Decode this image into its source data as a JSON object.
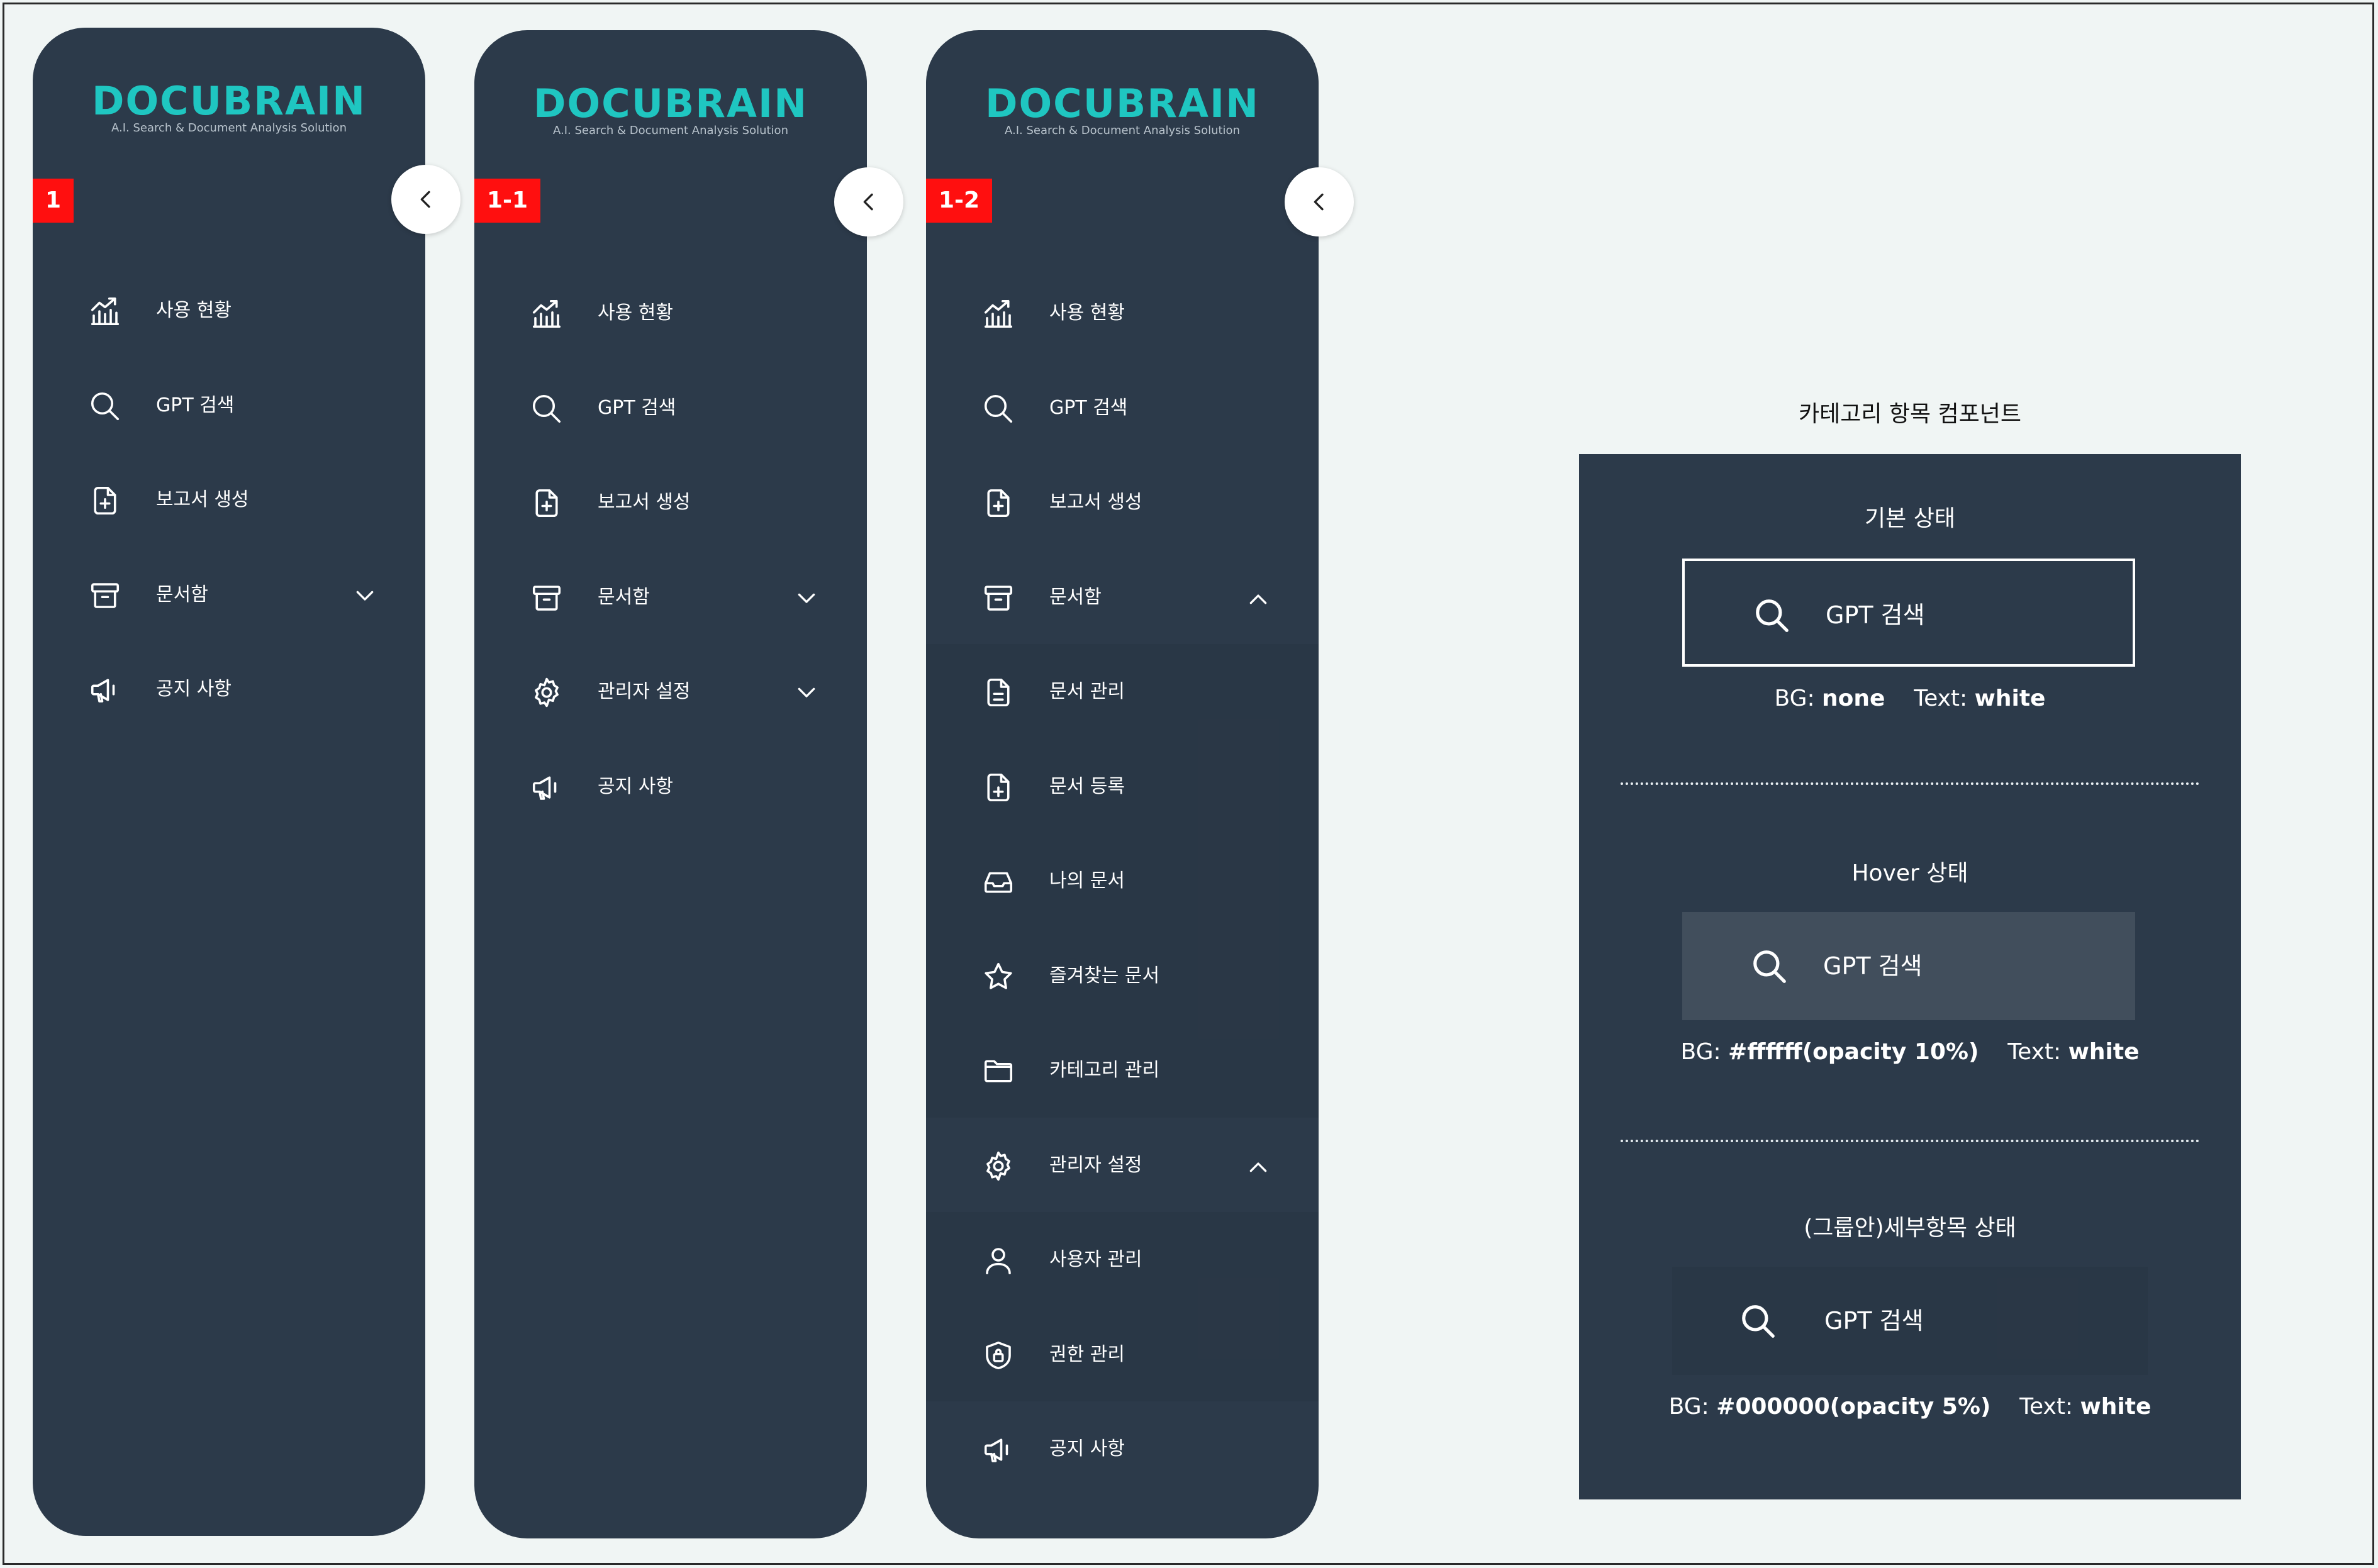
{
  "brand": {
    "name": "DOCUBRAIN",
    "tagline": "A.I. Search & Document Analysis Solution",
    "accent": "#1fc6c1"
  },
  "colors": {
    "sidebar_bg": "#2c3a4a",
    "badge": "#ff0f0f",
    "page_bg": "#f0f5f4"
  },
  "panels": [
    {
      "badge": "1",
      "items": [
        {
          "icon": "chart-icon",
          "label": "사용 현황"
        },
        {
          "icon": "search-icon",
          "label": "GPT 검색"
        },
        {
          "icon": "file-sparkle-icon",
          "label": "보고서 생성"
        },
        {
          "icon": "archive-icon",
          "label": "문서함",
          "chevron": "down"
        },
        {
          "icon": "megaphone-icon",
          "label": "공지 사항"
        }
      ]
    },
    {
      "badge": "1-1",
      "items": [
        {
          "icon": "chart-icon",
          "label": "사용 현황"
        },
        {
          "icon": "search-icon",
          "label": "GPT 검색"
        },
        {
          "icon": "file-sparkle-icon",
          "label": "보고서 생성"
        },
        {
          "icon": "archive-icon",
          "label": "문서함",
          "chevron": "down"
        },
        {
          "icon": "gear-icon",
          "label": "관리자 설정",
          "chevron": "down"
        },
        {
          "icon": "megaphone-icon",
          "label": "공지 사항"
        }
      ]
    },
    {
      "badge": "1-2",
      "items": [
        {
          "icon": "chart-icon",
          "label": "사용 현황"
        },
        {
          "icon": "search-icon",
          "label": "GPT 검색"
        },
        {
          "icon": "file-sparkle-icon",
          "label": "보고서 생성"
        },
        {
          "icon": "archive-icon",
          "label": "문서함",
          "chevron": "up"
        },
        {
          "icon": "document-icon",
          "label": "문서 관리",
          "sub": true
        },
        {
          "icon": "file-plus-icon",
          "label": "문서 등록",
          "sub": true
        },
        {
          "icon": "inbox-icon",
          "label": "나의 문서",
          "sub": true
        },
        {
          "icon": "star-icon",
          "label": "즐겨찾는 문서",
          "sub": true
        },
        {
          "icon": "folder-icon",
          "label": "카테고리 관리",
          "sub": true
        },
        {
          "icon": "gear-icon",
          "label": "관리자 설정",
          "chevron": "up"
        },
        {
          "icon": "user-icon",
          "label": "사용자 관리",
          "sub": true
        },
        {
          "icon": "shield-lock-icon",
          "label": "권한 관리",
          "sub": true
        },
        {
          "icon": "megaphone-icon",
          "label": "공지 사항"
        }
      ]
    }
  ],
  "spec": {
    "title": "카테고리 항목 컴포넌트",
    "states": [
      {
        "title": "기본 상태",
        "item_label": "GPT 검색",
        "bg_key": "BG:",
        "bg_val": "none",
        "text_key": "Text:",
        "text_val": "white"
      },
      {
        "title": "Hover 상태",
        "item_label": "GPT 검색",
        "bg_key": "BG:",
        "bg_val": "#ffffff(opacity 10%)",
        "text_key": "Text:",
        "text_val": "white"
      },
      {
        "title": "(그룹안)세부항목 상태",
        "item_label": "GPT 검색",
        "bg_key": "BG:",
        "bg_val": "#000000(opacity 5%)",
        "text_key": "Text:",
        "text_val": "white"
      }
    ]
  }
}
